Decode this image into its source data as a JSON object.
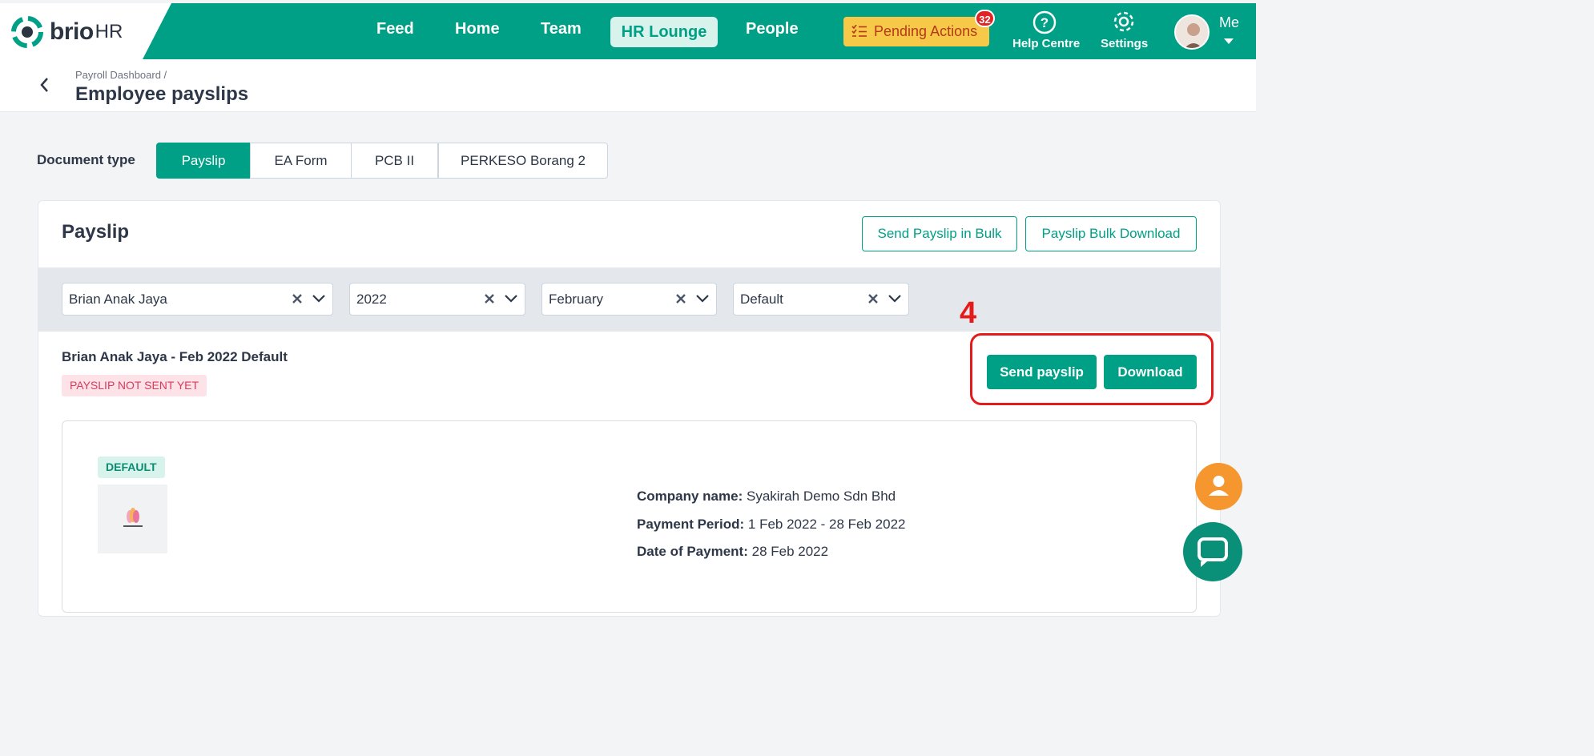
{
  "brand": {
    "name": "brio",
    "suffix": "HR"
  },
  "nav": {
    "items": [
      "Feed",
      "Home",
      "Team",
      "People"
    ],
    "active": "HR Lounge",
    "pending_label": "Pending Actions",
    "pending_count": "32",
    "help_label": "Help Centre",
    "settings_label": "Settings",
    "me_label": "Me"
  },
  "header": {
    "breadcrumb": "Payroll Dashboard  /",
    "title": "Employee payslips"
  },
  "document_type": {
    "label": "Document type",
    "options": [
      "Payslip",
      "EA Form",
      "PCB II",
      "PERKESO Borang 2"
    ],
    "selected": "Payslip"
  },
  "card": {
    "title": "Payslip",
    "send_bulk": "Send Payslip in Bulk",
    "bulk_download": "Payslip Bulk Download"
  },
  "filters": {
    "employee": "Brian Anak Jaya",
    "year": "2022",
    "month": "February",
    "template": "Default"
  },
  "annotation": {
    "step": "4",
    "color": "#e51b1b"
  },
  "payslip": {
    "title": "Brian Anak Jaya - Feb 2022 Default",
    "status": "PAYSLIP NOT SENT YET",
    "send_button": "Send payslip",
    "download_button": "Download",
    "tag": "DEFAULT",
    "company_label": "Company name:",
    "company_value": "Syakirah Demo Sdn Bhd",
    "period_label": "Payment Period:",
    "period_value": "1 Feb 2022 - 28 Feb 2022",
    "date_label": "Date of Payment:",
    "date_value": "28 Feb 2022"
  },
  "colors": {
    "primary": "#00a086",
    "pending_bg": "#f7c948",
    "alert": "#e02424"
  }
}
